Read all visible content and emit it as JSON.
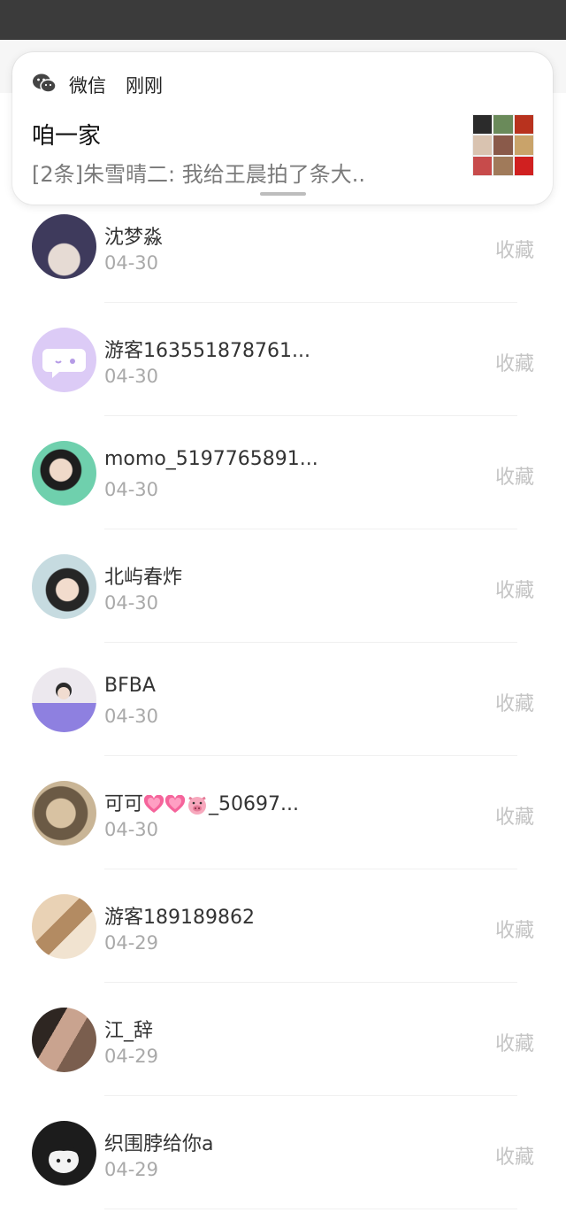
{
  "notification": {
    "app_name": "微信",
    "time": "刚刚",
    "title": "咱一家",
    "body": "[2条]朱雪晴二: 我给王晨拍了条大..",
    "app_icon": "wechat-icon"
  },
  "list": {
    "action_label": "收藏",
    "items": [
      {
        "name": "沈梦淼",
        "date": "04-30",
        "avatar_colors": [
          "#4a4266",
          "#d9ccc4"
        ]
      },
      {
        "name": "游客163551878761...",
        "date": "04-30",
        "avatar_colors": [
          "#d9c8f5",
          "#ffffff"
        ]
      },
      {
        "name": "momo_5197765891...",
        "date": "04-30",
        "avatar_colors": [
          "#5fc4a2",
          "#222222"
        ]
      },
      {
        "name": "北屿春炸",
        "date": "04-30",
        "avatar_colors": [
          "#b8d1d8",
          "#2b2b2b"
        ]
      },
      {
        "name": "BFBA",
        "date": "04-30",
        "avatar_colors": [
          "#e8e4ea",
          "#8a7cdc"
        ]
      },
      {
        "name_prefix": "可可",
        "name_suffix": "_50697...",
        "date": "04-30",
        "avatar_colors": [
          "#bfa98a",
          "#5a4c3a"
        ]
      },
      {
        "name": "游客189189862",
        "date": "04-29",
        "avatar_colors": [
          "#e6c9a8",
          "#8a6a4a"
        ]
      },
      {
        "name": "江_辞",
        "date": "04-29",
        "avatar_colors": [
          "#3a2f2a",
          "#c9a38f"
        ]
      },
      {
        "name": "织围脖给你a",
        "date": "04-29",
        "avatar_colors": [
          "#1c1c1c",
          "#f0f0f0"
        ]
      }
    ]
  }
}
